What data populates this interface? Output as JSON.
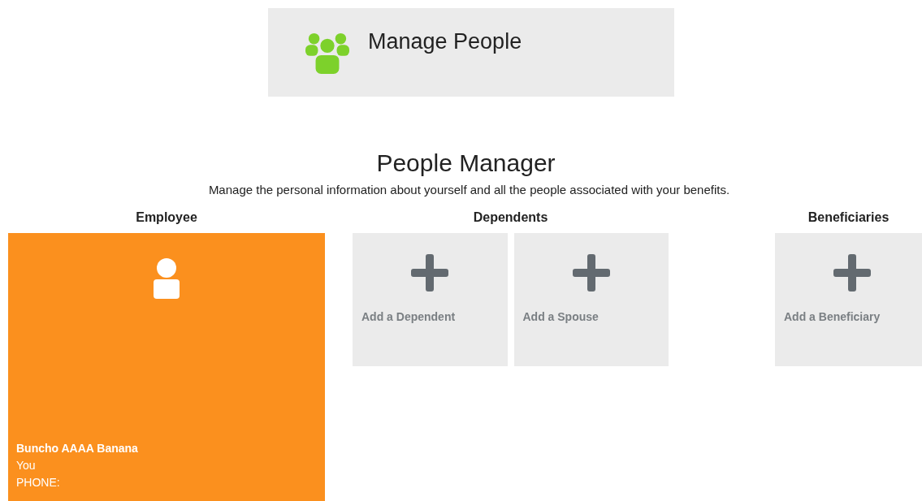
{
  "header": {
    "title": "Manage People"
  },
  "page_title": "People Manager",
  "subtitle": "Manage the personal information about yourself and all the people associated with your benefits.",
  "sections": [
    {
      "heading": "Employee",
      "kind": "employee",
      "person": {
        "name": "Buncho AAAA Banana",
        "relation": "You",
        "phone": "PHONE:"
      }
    },
    {
      "heading": "Dependents",
      "kind": "add",
      "tiles": [
        {
          "label": "Add a Dependent"
        },
        {
          "label": "Add a Spouse"
        }
      ]
    },
    {
      "heading": "Beneficiaries",
      "kind": "add",
      "tiles": [
        {
          "label": "Add a Beneficiary"
        }
      ]
    }
  ]
}
